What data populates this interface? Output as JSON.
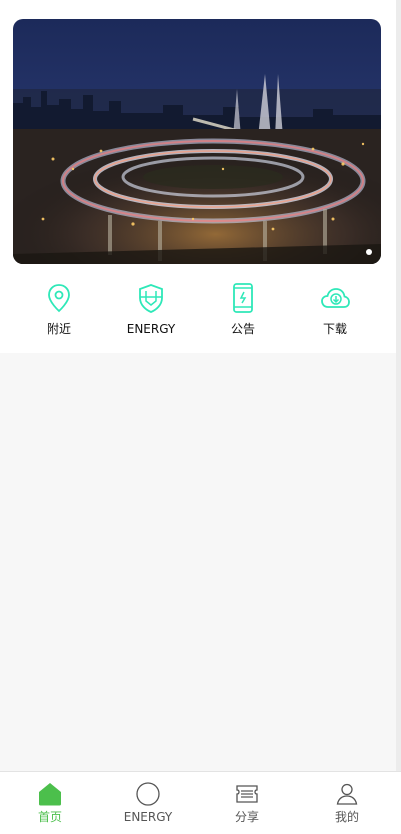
{
  "banner": {
    "image": "city-interchange-night-photo",
    "dots": 1
  },
  "quick_links": [
    {
      "label": "附近",
      "icon": "location-pin-icon"
    },
    {
      "label": "ENERGY",
      "icon": "shield-icon"
    },
    {
      "label": "公告",
      "icon": "phone-icon"
    },
    {
      "label": "下载",
      "icon": "cloud-download-icon"
    }
  ],
  "tabbar": {
    "items": [
      {
        "label": "首页",
        "icon": "home-icon",
        "active": true
      },
      {
        "label": "ENERGY",
        "icon": "circle-icon",
        "active": false
      },
      {
        "label": "分享",
        "icon": "ticket-icon",
        "active": false
      },
      {
        "label": "我的",
        "icon": "user-icon",
        "active": false
      }
    ]
  },
  "colors": {
    "accent_green": "#4cbf4c",
    "icon_teal": "#2ee8b8",
    "background": "#f7f7f7"
  }
}
